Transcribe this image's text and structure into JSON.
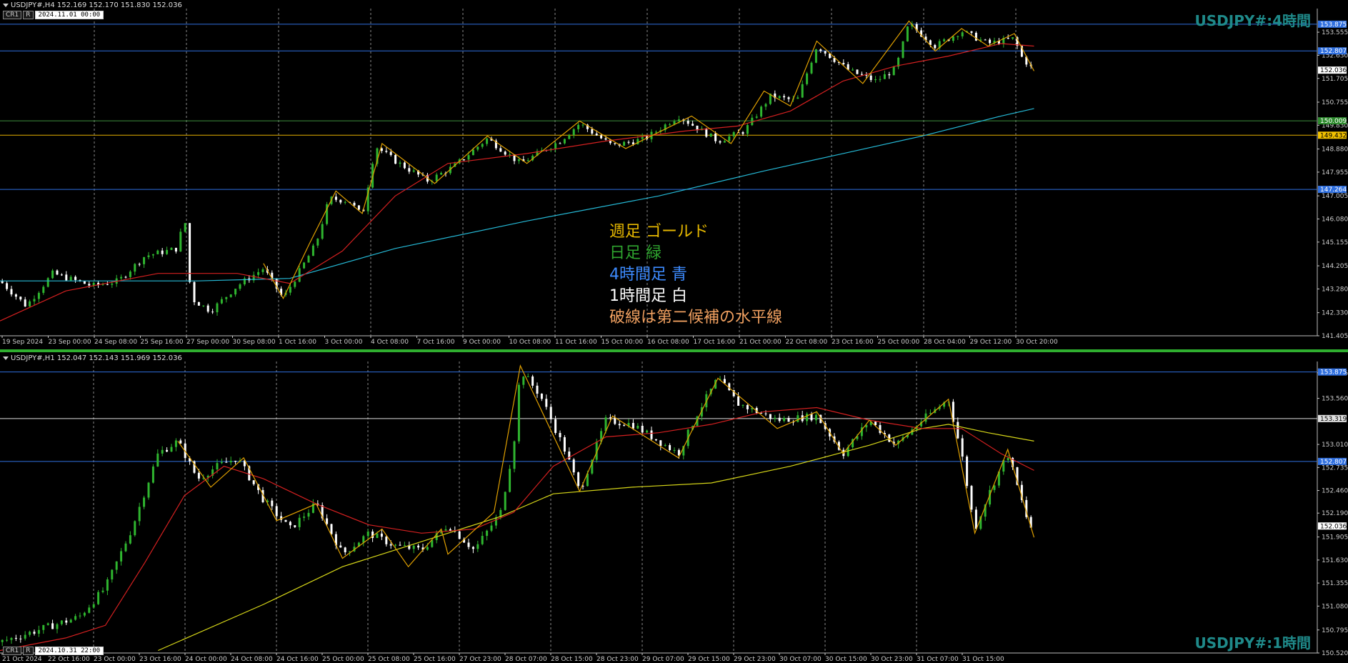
{
  "colors": {
    "background": "#000000",
    "bull_candle": "#2fb52f",
    "bear_candle": "#ffffff",
    "ma_red": "#d42020",
    "ma_cyan": "#25b9d6",
    "ma_yellow": "#d6d618",
    "zigzag": "#e0a000",
    "line_blue": "#2f6fdf",
    "line_green": "#3e8e3e",
    "line_gold": "#e6b000",
    "line_white": "#e0e0e0",
    "grid": "#888888",
    "watermark": "#1f8a8a"
  },
  "top_panel": {
    "header": "USDJPY#,H4  152.169 152.170 151.830 152.036",
    "control_buttons": [
      "CR1",
      "R"
    ],
    "control_date": "2024.11.01 00:00",
    "watermark": "USDJPY#:4時間",
    "legend": [
      {
        "text": "週足  ゴールド",
        "color": "#e6b800"
      },
      {
        "text": "日足  緑",
        "color": "#2fa52f"
      },
      {
        "text": "4時間足  青",
        "color": "#3d8bff"
      },
      {
        "text": "1時間足  白",
        "color": "#ffffff"
      },
      {
        "text": "破線は第二候補の水平線",
        "color": "#f0a060"
      }
    ]
  },
  "bottom_panel": {
    "header": "USDJPY#,H1  152.047 152.143 151.969 152.036",
    "control_buttons": [
      "CR1",
      "R"
    ],
    "control_date": "2024.10.31 22:00",
    "watermark": "USDJPY#:1時間"
  },
  "chart_data": [
    {
      "type": "candlestick",
      "symbol": "USDJPY#",
      "timeframe": "H4",
      "ylim": [
        141.405,
        154.5
      ],
      "y_ticks": [
        "153.555",
        "152.630",
        "151.705",
        "150.755",
        "149.830",
        "148.880",
        "147.955",
        "147.005",
        "146.080",
        "145.155",
        "144.205",
        "143.280",
        "142.330",
        "141.405"
      ],
      "x_ticks": [
        "19 Sep 2024",
        "23 Sep 00:00",
        "24 Sep 08:00",
        "25 Sep 16:00",
        "27 Sep 00:00",
        "30 Sep 08:00",
        "1 Oct 16:00",
        "3 Oct 00:00",
        "4 Oct 08:00",
        "7 Oct 16:00",
        "9 Oct 00:00",
        "10 Oct 08:00",
        "11 Oct 16:00",
        "15 Oct 00:00",
        "16 Oct 08:00",
        "17 Oct 16:00",
        "21 Oct 00:00",
        "22 Oct 08:00",
        "23 Oct 16:00",
        "25 Oct 00:00",
        "28 Oct 04:00",
        "29 Oct 12:00",
        "30 Oct 20:00"
      ],
      "horizontal_lines": [
        {
          "price": 153.875,
          "label": "153.875",
          "color": "#2f6fdf",
          "label_bg": "#2f6fdf"
        },
        {
          "price": 152.807,
          "label": "152.807",
          "color": "#2f6fdf",
          "label_bg": "#2f6fdf"
        },
        {
          "price": 150.009,
          "label": "150.009",
          "color": "#3e8e3e",
          "label_bg": "#2e8b2e"
        },
        {
          "price": 149.432,
          "label": "149.432",
          "color": "#e6b000",
          "label_bg": "#f2c200"
        },
        {
          "price": 147.264,
          "label": "147.264",
          "color": "#2f6fdf",
          "label_bg": "#2f6fdf"
        }
      ],
      "current_price": {
        "price": 152.036,
        "label": "152.036"
      },
      "price_path": [
        {
          "t": 0,
          "p": 143.6
        },
        {
          "t": 0.02,
          "p": 142.6
        },
        {
          "t": 0.04,
          "p": 143.9
        },
        {
          "t": 0.07,
          "p": 143.4
        },
        {
          "t": 0.09,
          "p": 143.6
        },
        {
          "t": 0.11,
          "p": 144.6
        },
        {
          "t": 0.135,
          "p": 144.9
        },
        {
          "t": 0.14,
          "p": 146.3
        },
        {
          "t": 0.145,
          "p": 142.9
        },
        {
          "t": 0.16,
          "p": 142.4
        },
        {
          "t": 0.18,
          "p": 143.4
        },
        {
          "t": 0.2,
          "p": 144.1
        },
        {
          "t": 0.215,
          "p": 142.9
        },
        {
          "t": 0.24,
          "p": 145.1
        },
        {
          "t": 0.25,
          "p": 146.9
        },
        {
          "t": 0.265,
          "p": 146.8
        },
        {
          "t": 0.275,
          "p": 146.2
        },
        {
          "t": 0.285,
          "p": 149.0
        },
        {
          "t": 0.3,
          "p": 148.4
        },
        {
          "t": 0.325,
          "p": 147.6
        },
        {
          "t": 0.345,
          "p": 148.2
        },
        {
          "t": 0.37,
          "p": 149.3
        },
        {
          "t": 0.395,
          "p": 148.3
        },
        {
          "t": 0.425,
          "p": 149.2
        },
        {
          "t": 0.44,
          "p": 149.9
        },
        {
          "t": 0.465,
          "p": 149.0
        },
        {
          "t": 0.49,
          "p": 149.3
        },
        {
          "t": 0.515,
          "p": 150.2
        },
        {
          "t": 0.545,
          "p": 149.2
        },
        {
          "t": 0.565,
          "p": 149.6
        },
        {
          "t": 0.585,
          "p": 151.0
        },
        {
          "t": 0.605,
          "p": 150.8
        },
        {
          "t": 0.62,
          "p": 153.0
        },
        {
          "t": 0.645,
          "p": 152.0
        },
        {
          "t": 0.665,
          "p": 151.6
        },
        {
          "t": 0.68,
          "p": 152.1
        },
        {
          "t": 0.69,
          "p": 153.9
        },
        {
          "t": 0.71,
          "p": 153.0
        },
        {
          "t": 0.73,
          "p": 153.6
        },
        {
          "t": 0.75,
          "p": 153.1
        },
        {
          "t": 0.77,
          "p": 153.3
        },
        {
          "t": 0.775,
          "p": 152.6
        },
        {
          "t": 0.785,
          "p": 152.0
        }
      ],
      "ma_red_path": [
        {
          "t": 0,
          "p": 142.0
        },
        {
          "t": 0.05,
          "p": 143.2
        },
        {
          "t": 0.12,
          "p": 143.9
        },
        {
          "t": 0.18,
          "p": 143.9
        },
        {
          "t": 0.22,
          "p": 143.5
        },
        {
          "t": 0.26,
          "p": 144.8
        },
        {
          "t": 0.3,
          "p": 147.0
        },
        {
          "t": 0.34,
          "p": 148.3
        },
        {
          "t": 0.4,
          "p": 148.7
        },
        {
          "t": 0.46,
          "p": 149.2
        },
        {
          "t": 0.52,
          "p": 149.6
        },
        {
          "t": 0.56,
          "p": 149.8
        },
        {
          "t": 0.6,
          "p": 150.4
        },
        {
          "t": 0.64,
          "p": 151.6
        },
        {
          "t": 0.68,
          "p": 152.2
        },
        {
          "t": 0.72,
          "p": 152.6
        },
        {
          "t": 0.76,
          "p": 153.1
        },
        {
          "t": 0.785,
          "p": 153.0
        }
      ],
      "ma_cyan_path": [
        {
          "t": 0,
          "p": 143.6
        },
        {
          "t": 0.15,
          "p": 143.6
        },
        {
          "t": 0.22,
          "p": 143.7
        },
        {
          "t": 0.3,
          "p": 144.9
        },
        {
          "t": 0.4,
          "p": 146.0
        },
        {
          "t": 0.5,
          "p": 147.0
        },
        {
          "t": 0.58,
          "p": 148.0
        },
        {
          "t": 0.64,
          "p": 148.7
        },
        {
          "t": 0.7,
          "p": 149.4
        },
        {
          "t": 0.76,
          "p": 150.2
        },
        {
          "t": 0.785,
          "p": 150.5
        }
      ],
      "zigzag_path": [
        {
          "t": 0.2,
          "p": 144.3
        },
        {
          "t": 0.215,
          "p": 142.9
        },
        {
          "t": 0.235,
          "p": 145.1
        },
        {
          "t": 0.255,
          "p": 147.2
        },
        {
          "t": 0.275,
          "p": 146.3
        },
        {
          "t": 0.29,
          "p": 149.1
        },
        {
          "t": 0.33,
          "p": 147.5
        },
        {
          "t": 0.37,
          "p": 149.4
        },
        {
          "t": 0.4,
          "p": 148.3
        },
        {
          "t": 0.44,
          "p": 150.0
        },
        {
          "t": 0.475,
          "p": 148.9
        },
        {
          "t": 0.525,
          "p": 150.2
        },
        {
          "t": 0.555,
          "p": 149.1
        },
        {
          "t": 0.58,
          "p": 151.2
        },
        {
          "t": 0.6,
          "p": 150.6
        },
        {
          "t": 0.62,
          "p": 153.2
        },
        {
          "t": 0.655,
          "p": 151.5
        },
        {
          "t": 0.69,
          "p": 154.0
        },
        {
          "t": 0.71,
          "p": 152.8
        },
        {
          "t": 0.73,
          "p": 153.7
        },
        {
          "t": 0.75,
          "p": 153.0
        },
        {
          "t": 0.77,
          "p": 153.5
        },
        {
          "t": 0.785,
          "p": 152.0
        }
      ]
    },
    {
      "type": "candlestick",
      "symbol": "USDJPY#",
      "timeframe": "H1",
      "ylim": [
        150.52,
        154.0
      ],
      "y_ticks": [
        "153.865",
        "153.560",
        "153.010",
        "152.735",
        "152.460",
        "152.190",
        "151.905",
        "151.630",
        "151.355",
        "151.080",
        "150.795",
        "150.520"
      ],
      "x_ticks": [
        "21 Oct 2024",
        "22 Oct 16:00",
        "23 Oct 00:00",
        "23 Oct 16:00",
        "24 Oct 00:00",
        "24 Oct 08:00",
        "24 Oct 16:00",
        "25 Oct 00:00",
        "25 Oct 08:00",
        "25 Oct 16:00",
        "27 Oct 23:00",
        "28 Oct 07:00",
        "28 Oct 15:00",
        "28 Oct 23:00",
        "29 Oct 07:00",
        "29 Oct 15:00",
        "29 Oct 23:00",
        "30 Oct 07:00",
        "30 Oct 15:00",
        "30 Oct 23:00",
        "31 Oct 07:00",
        "31 Oct 15:00"
      ],
      "horizontal_lines": [
        {
          "price": 153.875,
          "label": "153.875",
          "color": "#2f6fdf",
          "label_bg": "#2f6fdf"
        },
        {
          "price": 153.319,
          "label": "153.319",
          "color": "#e0e0e0",
          "label_bg": "#e0e0e0"
        },
        {
          "price": 152.807,
          "label": "152.807",
          "color": "#2f6fdf",
          "label_bg": "#2f6fdf"
        }
      ],
      "current_price": {
        "price": 152.036,
        "label": "152.036"
      },
      "price_path": [
        {
          "t": 0,
          "p": 150.65
        },
        {
          "t": 0.03,
          "p": 150.8
        },
        {
          "t": 0.06,
          "p": 150.95
        },
        {
          "t": 0.08,
          "p": 151.3
        },
        {
          "t": 0.1,
          "p": 152.0
        },
        {
          "t": 0.12,
          "p": 152.9
        },
        {
          "t": 0.135,
          "p": 153.05
        },
        {
          "t": 0.15,
          "p": 152.6
        },
        {
          "t": 0.165,
          "p": 152.75
        },
        {
          "t": 0.18,
          "p": 152.85
        },
        {
          "t": 0.2,
          "p": 152.35
        },
        {
          "t": 0.22,
          "p": 152.0
        },
        {
          "t": 0.24,
          "p": 152.3
        },
        {
          "t": 0.26,
          "p": 151.7
        },
        {
          "t": 0.28,
          "p": 151.95
        },
        {
          "t": 0.3,
          "p": 151.8
        },
        {
          "t": 0.32,
          "p": 151.75
        },
        {
          "t": 0.34,
          "p": 152.05
        },
        {
          "t": 0.36,
          "p": 151.75
        },
        {
          "t": 0.38,
          "p": 152.2
        },
        {
          "t": 0.39,
          "p": 153.0
        },
        {
          "t": 0.395,
          "p": 153.9
        },
        {
          "t": 0.41,
          "p": 153.6
        },
        {
          "t": 0.43,
          "p": 152.9
        },
        {
          "t": 0.44,
          "p": 152.45
        },
        {
          "t": 0.46,
          "p": 153.3
        },
        {
          "t": 0.48,
          "p": 153.25
        },
        {
          "t": 0.5,
          "p": 153.05
        },
        {
          "t": 0.515,
          "p": 152.9
        },
        {
          "t": 0.53,
          "p": 153.4
        },
        {
          "t": 0.545,
          "p": 153.8
        },
        {
          "t": 0.56,
          "p": 153.5
        },
        {
          "t": 0.59,
          "p": 153.3
        },
        {
          "t": 0.62,
          "p": 153.35
        },
        {
          "t": 0.64,
          "p": 152.9
        },
        {
          "t": 0.66,
          "p": 153.3
        },
        {
          "t": 0.68,
          "p": 153.0
        },
        {
          "t": 0.7,
          "p": 153.3
        },
        {
          "t": 0.72,
          "p": 153.55
        },
        {
          "t": 0.73,
          "p": 152.9
        },
        {
          "t": 0.74,
          "p": 152.0
        },
        {
          "t": 0.75,
          "p": 152.4
        },
        {
          "t": 0.765,
          "p": 152.9
        },
        {
          "t": 0.78,
          "p": 152.1
        },
        {
          "t": 0.785,
          "p": 151.95
        }
      ],
      "ma_red_path": [
        {
          "t": 0,
          "p": 150.55
        },
        {
          "t": 0.05,
          "p": 150.7
        },
        {
          "t": 0.08,
          "p": 150.85
        },
        {
          "t": 0.11,
          "p": 151.6
        },
        {
          "t": 0.14,
          "p": 152.4
        },
        {
          "t": 0.17,
          "p": 152.75
        },
        {
          "t": 0.2,
          "p": 152.6
        },
        {
          "t": 0.24,
          "p": 152.3
        },
        {
          "t": 0.28,
          "p": 152.05
        },
        {
          "t": 0.32,
          "p": 151.95
        },
        {
          "t": 0.36,
          "p": 152.0
        },
        {
          "t": 0.39,
          "p": 152.2
        },
        {
          "t": 0.42,
          "p": 152.75
        },
        {
          "t": 0.46,
          "p": 153.1
        },
        {
          "t": 0.5,
          "p": 153.15
        },
        {
          "t": 0.54,
          "p": 153.25
        },
        {
          "t": 0.58,
          "p": 153.4
        },
        {
          "t": 0.62,
          "p": 153.45
        },
        {
          "t": 0.66,
          "p": 153.3
        },
        {
          "t": 0.7,
          "p": 153.2
        },
        {
          "t": 0.73,
          "p": 153.2
        },
        {
          "t": 0.76,
          "p": 152.9
        },
        {
          "t": 0.785,
          "p": 152.7
        }
      ],
      "ma_yellow_path": [
        {
          "t": 0.12,
          "p": 150.55
        },
        {
          "t": 0.2,
          "p": 151.1
        },
        {
          "t": 0.26,
          "p": 151.55
        },
        {
          "t": 0.32,
          "p": 151.85
        },
        {
          "t": 0.38,
          "p": 152.15
        },
        {
          "t": 0.42,
          "p": 152.42
        },
        {
          "t": 0.48,
          "p": 152.5
        },
        {
          "t": 0.54,
          "p": 152.55
        },
        {
          "t": 0.6,
          "p": 152.75
        },
        {
          "t": 0.66,
          "p": 153.0
        },
        {
          "t": 0.7,
          "p": 153.2
        },
        {
          "t": 0.72,
          "p": 153.25
        },
        {
          "t": 0.75,
          "p": 153.15
        },
        {
          "t": 0.785,
          "p": 153.05
        }
      ],
      "zigzag_path": [
        {
          "t": 0.135,
          "p": 153.05
        },
        {
          "t": 0.16,
          "p": 152.5
        },
        {
          "t": 0.185,
          "p": 152.85
        },
        {
          "t": 0.21,
          "p": 152.1
        },
        {
          "t": 0.24,
          "p": 152.3
        },
        {
          "t": 0.26,
          "p": 151.65
        },
        {
          "t": 0.29,
          "p": 152.0
        },
        {
          "t": 0.31,
          "p": 151.55
        },
        {
          "t": 0.335,
          "p": 152.0
        },
        {
          "t": 0.34,
          "p": 151.7
        },
        {
          "t": 0.375,
          "p": 152.2
        },
        {
          "t": 0.395,
          "p": 153.95
        },
        {
          "t": 0.44,
          "p": 152.45
        },
        {
          "t": 0.465,
          "p": 153.35
        },
        {
          "t": 0.515,
          "p": 152.85
        },
        {
          "t": 0.545,
          "p": 153.8
        },
        {
          "t": 0.59,
          "p": 153.2
        },
        {
          "t": 0.62,
          "p": 153.4
        },
        {
          "t": 0.64,
          "p": 152.9
        },
        {
          "t": 0.66,
          "p": 153.3
        },
        {
          "t": 0.68,
          "p": 153.0
        },
        {
          "t": 0.72,
          "p": 153.55
        },
        {
          "t": 0.74,
          "p": 151.95
        },
        {
          "t": 0.765,
          "p": 152.95
        },
        {
          "t": 0.785,
          "p": 151.9
        }
      ]
    }
  ]
}
